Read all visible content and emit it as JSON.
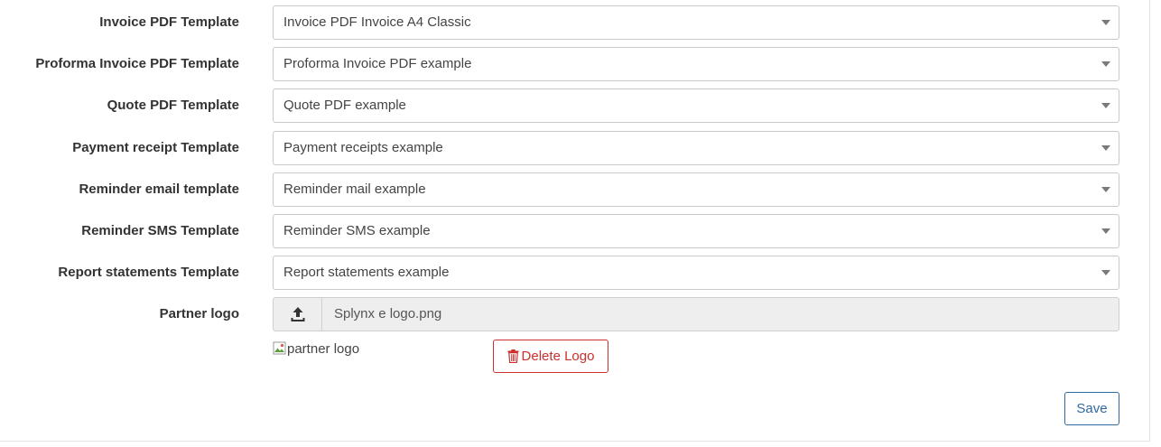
{
  "templates": [
    {
      "label": "Invoice PDF Template",
      "value": "Invoice PDF Invoice A4 Classic"
    },
    {
      "label": "Proforma Invoice PDF Template",
      "value": "Proforma Invoice PDF example"
    },
    {
      "label": "Quote PDF Template",
      "value": "Quote PDF example"
    },
    {
      "label": "Payment receipt Template",
      "value": "Payment receipts example"
    },
    {
      "label": "Reminder email template",
      "value": "Reminder mail example"
    },
    {
      "label": "Reminder SMS Template",
      "value": "Reminder SMS example"
    },
    {
      "label": "Report statements Template",
      "value": "Report statements example"
    }
  ],
  "partner_logo": {
    "label": "Partner logo",
    "file_name": "Splynx e logo.png",
    "image_alt": "partner logo",
    "upload_icon": "upload-icon",
    "delete_label": "Delete Logo",
    "delete_icon": "trash-icon"
  },
  "actions": {
    "save_label": "Save"
  },
  "colors": {
    "danger": "#c9302c",
    "primary": "#2f6aa3"
  }
}
